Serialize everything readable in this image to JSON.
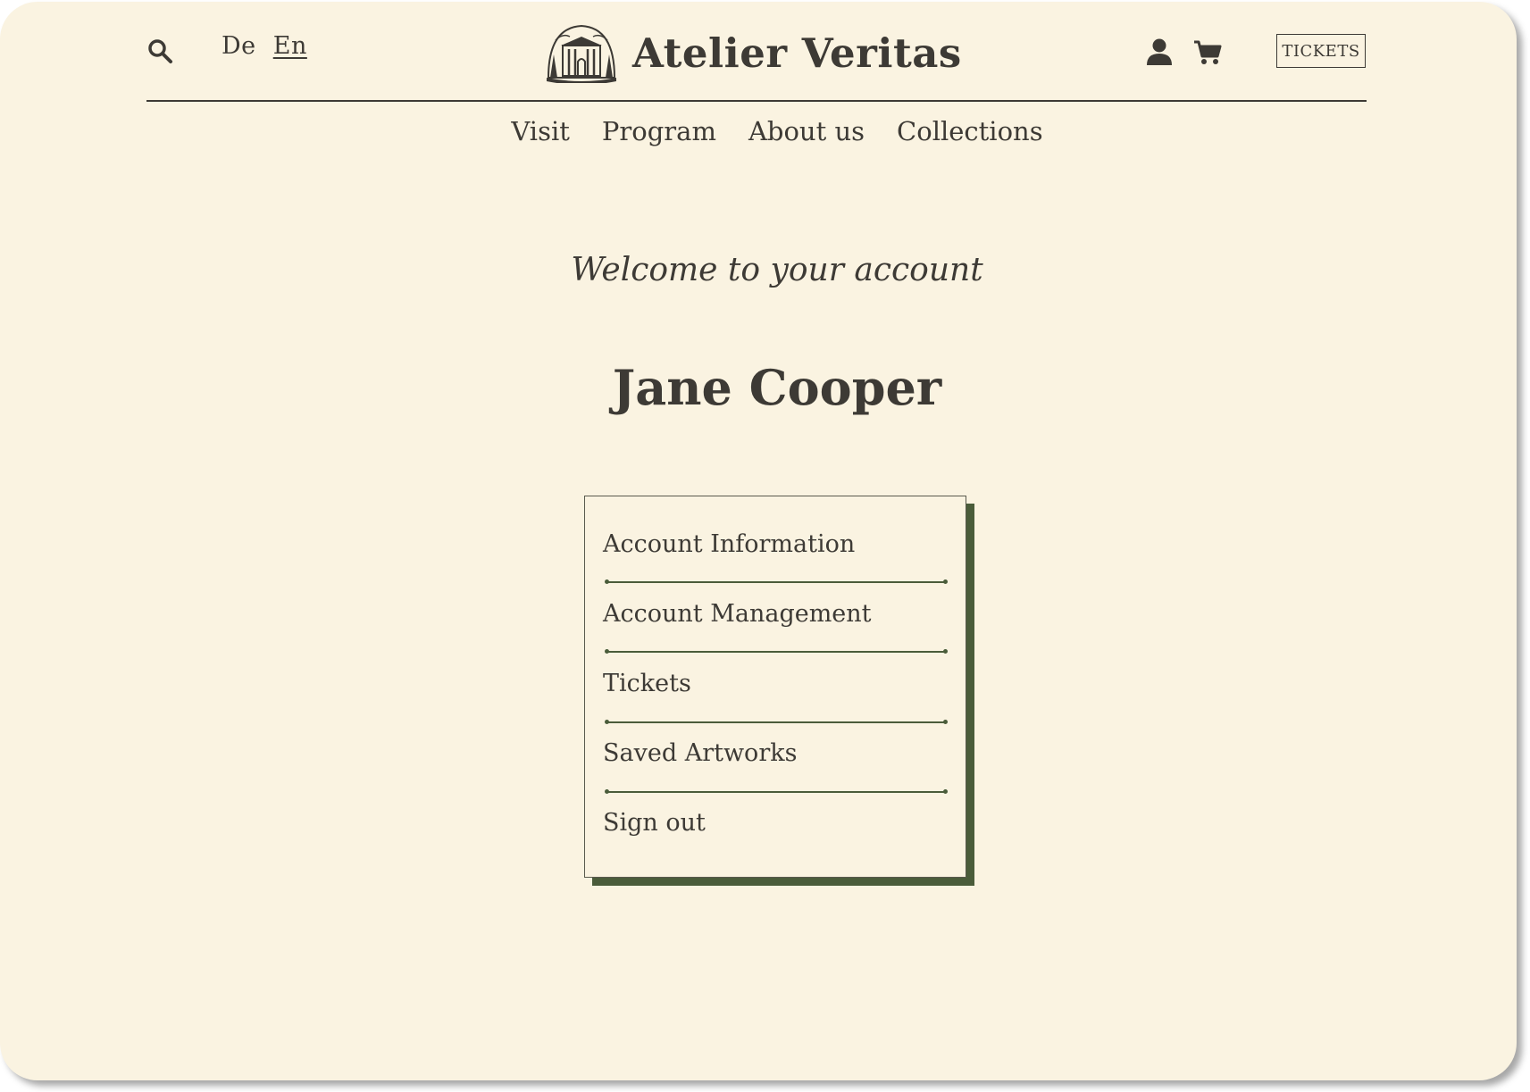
{
  "brand": {
    "name": "Atelier Veritas",
    "logo_icon": "museum-dome-icon"
  },
  "header": {
    "search_icon": "search-icon",
    "languages": [
      "De",
      "En"
    ],
    "active_language": "En",
    "user_icon": "user-icon",
    "cart_icon": "cart-icon",
    "tickets_label": "TICKETS"
  },
  "nav": {
    "items": [
      "Visit",
      "Program",
      "About us",
      "Collections"
    ]
  },
  "account": {
    "welcome": "Welcome to your account",
    "user_name": "Jane Cooper",
    "menu": [
      "Account Information",
      "Account Management",
      "Tickets",
      "Saved Artworks",
      "Sign out"
    ]
  },
  "colors": {
    "background": "#faf3e1",
    "text": "#3d3a35",
    "accent_green": "#4a5c3a"
  }
}
